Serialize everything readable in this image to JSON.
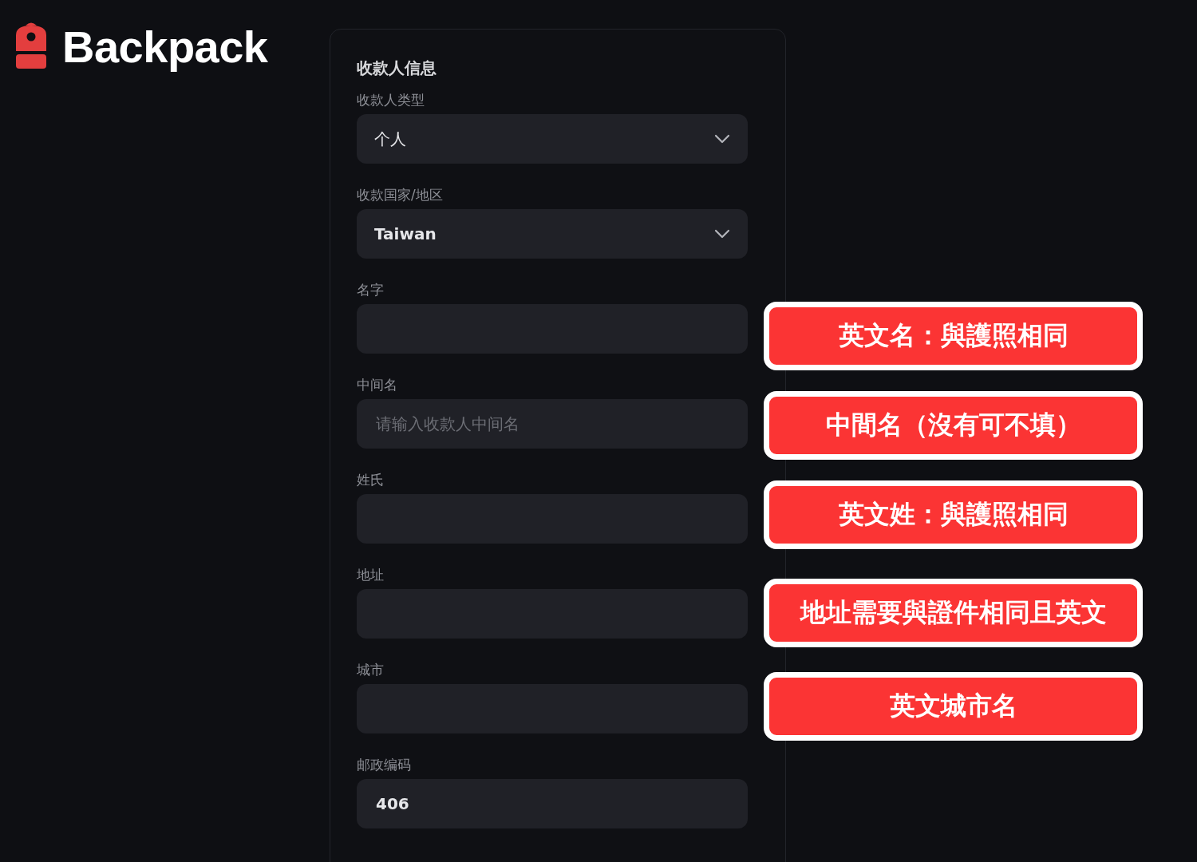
{
  "brand": {
    "name": "Backpack"
  },
  "form": {
    "title": "收款人信息",
    "fields": [
      {
        "label": "收款人类型",
        "kind": "select",
        "value": "个人"
      },
      {
        "label": "收款国家/地区",
        "kind": "select",
        "value": "Taiwan"
      },
      {
        "label": "名字",
        "kind": "input"
      },
      {
        "label": "中间名",
        "kind": "input",
        "placeholder": "请输入收款人中间名"
      },
      {
        "label": "姓氏",
        "kind": "input"
      },
      {
        "label": "地址",
        "kind": "input"
      },
      {
        "label": "城市",
        "kind": "input"
      },
      {
        "label": "邮政编码",
        "kind": "input",
        "value": "406"
      }
    ]
  },
  "callouts": [
    {
      "text": "英文名：與護照相同"
    },
    {
      "text": "中間名（沒有可不填）"
    },
    {
      "text": "英文姓：與護照相同"
    },
    {
      "text": "地址需要與證件相同且英文"
    },
    {
      "text": "英文城市名"
    }
  ]
}
